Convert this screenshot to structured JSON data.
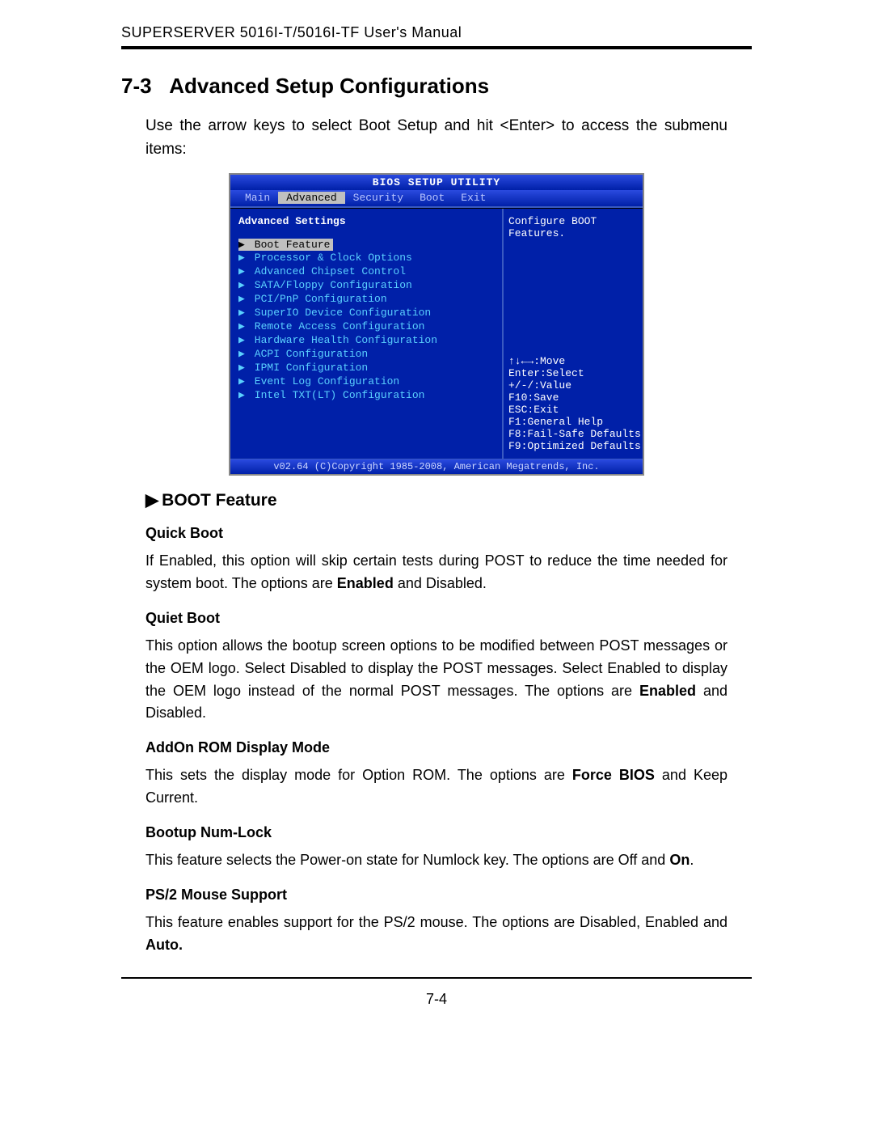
{
  "header": "SUPERSERVER 5016I-T/5016I-TF User's Manual",
  "section_number": "7-3",
  "section_title": "Advanced Setup Configurations",
  "intro": "Use the arrow keys to select Boot Setup and hit <Enter> to access the submenu items:",
  "bios": {
    "title": "BIOS SETUP UTILITY",
    "tabs": [
      "Main",
      "Advanced",
      "Security",
      "Boot",
      "Exit"
    ],
    "active_tab": "Advanced",
    "left_heading": "Advanced Settings",
    "items": [
      "Boot Feature",
      "Processor & Clock Options",
      "Advanced Chipset Control",
      "SATA/Floppy Configuration",
      "PCI/PnP Configuration",
      "SuperIO Device Configuration",
      "Remote Access Configuration",
      "Hardware Health Configuration",
      "ACPI Configuration",
      "IPMI Configuration",
      "Event Log Configuration",
      "Intel TXT(LT) Configuration"
    ],
    "selected_index": 0,
    "help_text": "Configure BOOT Features.",
    "keys": [
      "↑↓←→:Move",
      "Enter:Select",
      "+/-/:Value",
      "F10:Save",
      "ESC:Exit",
      "F1:General Help",
      "F8:Fail-Safe Defaults",
      "F9:Optimized Defaults"
    ],
    "footer": "v02.64 (C)Copyright 1985-2008, American Megatrends, Inc."
  },
  "subsection": "BOOT Feature",
  "features": [
    {
      "name": "Quick Boot",
      "desc_pre": "If Enabled, this option will skip certain tests during POST to reduce the time needed for system boot. The options are ",
      "bold": "Enabled",
      "desc_post": " and Disabled."
    },
    {
      "name": "Quiet Boot",
      "desc_pre": "This option allows the bootup screen options to be modified between POST messages or the OEM logo. Select Disabled to display the POST messages. Select Enabled to display the OEM logo instead of the normal POST messages. The options are ",
      "bold": "Enabled",
      "desc_post": " and Disabled."
    },
    {
      "name": "AddOn ROM Display Mode",
      "desc_pre": "This sets the display mode for Option ROM.  The options are ",
      "bold": "Force BIOS",
      "desc_post": " and Keep Current."
    },
    {
      "name": "Bootup Num-Lock",
      "desc_pre": "This feature selects the Power-on state for Numlock key.  The options are Off and ",
      "bold": "On",
      "desc_post": "."
    },
    {
      "name": "PS/2 Mouse Support",
      "desc_pre": "This feature enables support for the PS/2 mouse.  The options are Disabled, Enabled and ",
      "bold": "Auto.",
      "desc_post": ""
    }
  ],
  "page_number": "7-4"
}
